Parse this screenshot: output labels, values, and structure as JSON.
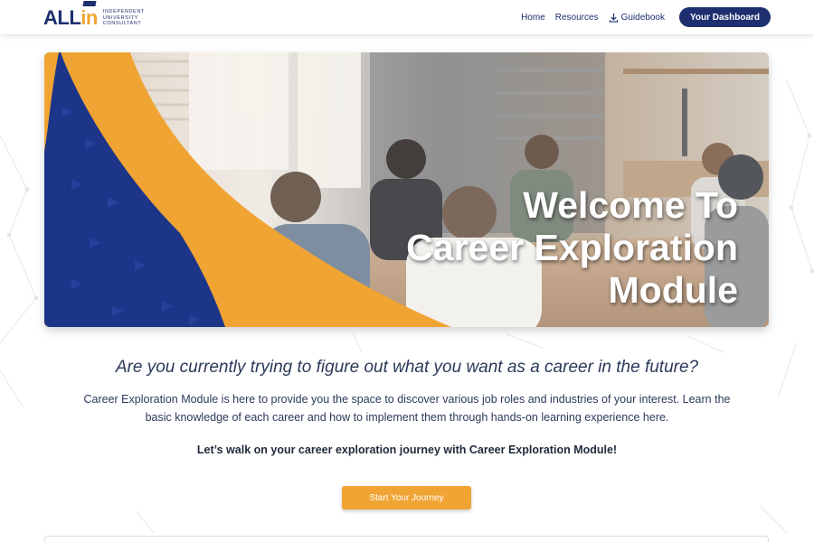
{
  "logo": {
    "main_text": "ALL",
    "accent_text": "in",
    "tagline": [
      "Independent",
      "University",
      "Consultant"
    ],
    "brand_color": "#1d2f6f",
    "accent_color": "#f0a433"
  },
  "nav": {
    "links": [
      {
        "label": "Home"
      },
      {
        "label": "Resources"
      },
      {
        "label": "Guidebook",
        "icon": "download-icon"
      }
    ],
    "dashboard_button": "Your Dashboard"
  },
  "hero": {
    "title_lines": [
      "Welcome To",
      "Career Exploration",
      "Module"
    ]
  },
  "intro": {
    "question": "Are you currently trying to figure out what you want as a career in the future?",
    "description": "Career Exploration Module is here to provide you the space to discover various job roles and industries of your interest. Learn the basic knowledge of each career and how to implement them through hands-on learning experience here.",
    "call_to_action": "Let’s walk on your career exploration journey with Career Exploration Module!",
    "start_button": "Start Your Journey"
  }
}
